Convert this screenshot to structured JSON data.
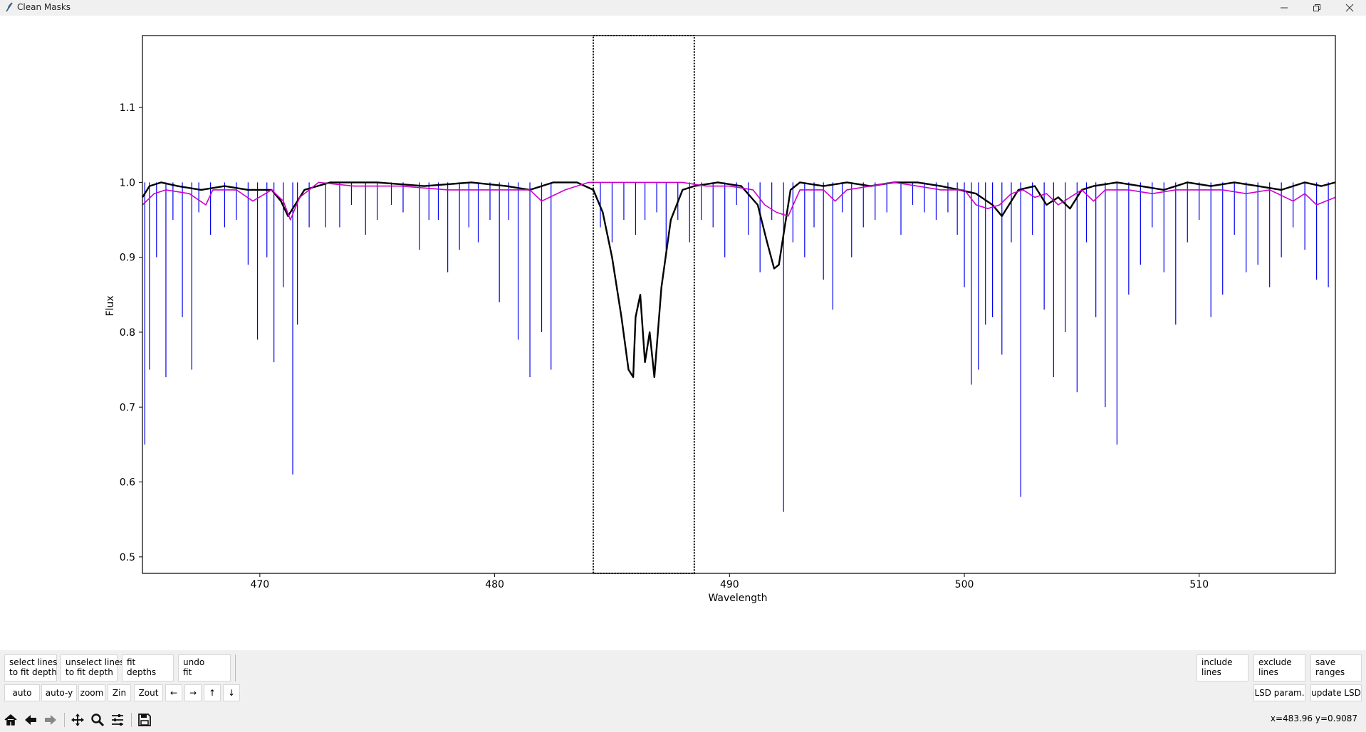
{
  "window": {
    "title": "Clean Masks"
  },
  "toolbar_row1_left": [
    {
      "name": "select-lines-button",
      "label": "select lines\nto fit depth"
    },
    {
      "name": "unselect-lines-button",
      "label": "unselect lines\nto fit depth"
    },
    {
      "name": "fit-depths-button",
      "label": "fit\ndepths"
    },
    {
      "name": "undo-fit-button",
      "label": "undo\nfit"
    }
  ],
  "toolbar_row1_right": [
    {
      "name": "include-lines-button",
      "label": "include\nlines"
    },
    {
      "name": "exclude-lines-button",
      "label": "exclude\nlines"
    },
    {
      "name": "save-ranges-button",
      "label": "save\nranges"
    }
  ],
  "toolbar_row2_left": [
    {
      "name": "auto-button",
      "label": "auto"
    },
    {
      "name": "auto-y-button",
      "label": "auto-y"
    },
    {
      "name": "zoom-button",
      "label": "zoom"
    },
    {
      "name": "zoom-in-button",
      "label": "Zin"
    },
    {
      "name": "zoom-out-button",
      "label": "Zout"
    },
    {
      "name": "pan-left-button",
      "label": "←"
    },
    {
      "name": "pan-right-button",
      "label": "→"
    },
    {
      "name": "pan-up-button",
      "label": "↑"
    },
    {
      "name": "pan-down-button",
      "label": "↓"
    }
  ],
  "toolbar_row2_right": [
    {
      "name": "lsd-param-button",
      "label": "LSD param."
    },
    {
      "name": "update-lsd-button",
      "label": "update LSD"
    }
  ],
  "nav_tools": [
    "home-icon",
    "back-arrow-icon",
    "forward-arrow-icon",
    "pan-move-icon",
    "zoom-magnifier-icon",
    "configure-subplots-icon",
    "save-floppy-icon"
  ],
  "status": {
    "coords": "x=483.96 y=0.9087"
  },
  "colors": {
    "spectrum": "#000000",
    "model": "#cc00cc",
    "mask_lines": "#0000ee"
  },
  "chart_data": {
    "type": "line",
    "xlabel": "Wavelength",
    "ylabel": "Flux",
    "xlim": [
      465,
      515.8
    ],
    "ylim": [
      0.478,
      1.196
    ],
    "xticks": [
      470,
      480,
      490,
      500,
      510
    ],
    "yticks": [
      0.5,
      0.6,
      0.7,
      0.8,
      0.9,
      1.0,
      1.1
    ],
    "grid": false,
    "selection_range": [
      484.2,
      488.5
    ],
    "series": [
      {
        "kind": "observed-spectrum",
        "x": [
          465.0,
          465.3,
          465.8,
          466.5,
          467.5,
          468.5,
          469.5,
          470.5,
          470.9,
          471.2,
          471.5,
          471.9,
          473,
          475,
          477,
          479,
          480.5,
          481.5,
          482.5,
          483.5,
          484.2,
          484.6,
          485.0,
          485.4,
          485.7,
          485.9,
          486.0,
          486.2,
          486.4,
          486.6,
          486.8,
          487.1,
          487.5,
          488.0,
          488.5,
          489.5,
          490.5,
          491.2,
          491.6,
          491.9,
          492.1,
          492.3,
          492.6,
          493.0,
          494,
          495,
          496,
          497,
          498,
          499,
          499.8,
          500.5,
          501.2,
          501.6,
          501.9,
          502.3,
          503,
          503.5,
          504,
          504.5,
          505,
          505.5,
          506.5,
          507.5,
          508.5,
          509.5,
          510.5,
          511.5,
          512.5,
          513.5,
          514.5,
          515.2,
          515.8
        ],
        "y": [
          0.98,
          0.995,
          1.0,
          0.995,
          0.99,
          0.995,
          0.99,
          0.99,
          0.975,
          0.955,
          0.97,
          0.99,
          1.0,
          1.0,
          0.995,
          1.0,
          0.995,
          0.99,
          1.0,
          1.0,
          0.99,
          0.96,
          0.9,
          0.82,
          0.75,
          0.74,
          0.82,
          0.85,
          0.76,
          0.8,
          0.74,
          0.86,
          0.95,
          0.99,
          0.995,
          1.0,
          0.995,
          0.97,
          0.92,
          0.885,
          0.89,
          0.93,
          0.99,
          1.0,
          0.995,
          1.0,
          0.995,
          1.0,
          1.0,
          0.995,
          0.99,
          0.985,
          0.97,
          0.955,
          0.97,
          0.99,
          0.995,
          0.97,
          0.98,
          0.965,
          0.99,
          0.995,
          1.0,
          0.995,
          0.99,
          1.0,
          0.995,
          1.0,
          0.995,
          0.99,
          1.0,
          0.995,
          1.0
        ]
      },
      {
        "kind": "model-spectrum",
        "x": [
          465.0,
          465.5,
          466,
          467,
          467.7,
          468,
          469,
          469.7,
          470.5,
          471,
          471.3,
          471.7,
          472.5,
          474,
          476,
          478,
          480,
          481.5,
          482,
          483,
          484,
          485,
          486,
          487,
          488,
          489,
          490,
          491,
          491.5,
          492,
          492.5,
          493,
          494,
          494.5,
          495,
          496,
          497,
          498,
          499,
          500,
          500.5,
          501,
          501.5,
          502,
          502.5,
          503,
          503.5,
          504,
          505,
          505.5,
          506,
          507,
          508,
          509,
          510,
          511,
          512,
          513,
          514,
          514.5,
          515,
          515.8
        ],
        "y": [
          0.97,
          0.985,
          0.99,
          0.985,
          0.97,
          0.99,
          0.99,
          0.975,
          0.99,
          0.975,
          0.95,
          0.98,
          1.0,
          0.995,
          0.995,
          0.99,
          0.99,
          0.99,
          0.975,
          0.99,
          1.0,
          1.0,
          1.0,
          1.0,
          1.0,
          0.995,
          0.995,
          0.99,
          0.97,
          0.96,
          0.955,
          0.99,
          0.99,
          0.975,
          0.99,
          0.995,
          1.0,
          0.995,
          0.99,
          0.99,
          0.97,
          0.965,
          0.97,
          0.985,
          0.99,
          0.98,
          0.985,
          0.97,
          0.99,
          0.975,
          0.99,
          0.99,
          0.985,
          0.99,
          0.99,
          0.99,
          0.985,
          0.99,
          0.975,
          0.985,
          0.97,
          0.98
        ]
      }
    ],
    "mask_lines": {
      "x": [
        465.1,
        465.3,
        465.6,
        466.0,
        466.3,
        466.7,
        467.1,
        467.4,
        467.9,
        468.5,
        469.0,
        469.5,
        469.9,
        470.3,
        470.6,
        471.0,
        471.4,
        471.6,
        472.1,
        472.8,
        473.4,
        473.9,
        474.5,
        475.0,
        475.6,
        476.1,
        476.8,
        477.2,
        477.6,
        478.0,
        478.5,
        478.9,
        479.3,
        479.8,
        480.2,
        480.6,
        481.0,
        481.5,
        482.0,
        482.4,
        484.5,
        485.0,
        485.5,
        486.0,
        486.4,
        486.9,
        487.3,
        487.8,
        488.3,
        488.8,
        489.3,
        489.8,
        490.3,
        490.8,
        491.3,
        491.8,
        492.3,
        492.7,
        493.2,
        493.6,
        494.0,
        494.4,
        494.8,
        495.2,
        495.7,
        496.2,
        496.7,
        497.3,
        497.8,
        498.3,
        498.8,
        499.3,
        499.7,
        500.0,
        500.3,
        500.6,
        500.9,
        501.2,
        501.6,
        502.0,
        502.4,
        502.9,
        503.4,
        503.8,
        504.3,
        504.8,
        505.2,
        505.6,
        506.0,
        506.5,
        507.0,
        507.5,
        508.0,
        508.5,
        509.0,
        509.5,
        510.0,
        510.5,
        511.0,
        511.5,
        512.0,
        512.5,
        513.0,
        513.5,
        514.0,
        514.5,
        515.0,
        515.5
      ],
      "depth": [
        0.35,
        0.25,
        0.1,
        0.26,
        0.05,
        0.18,
        0.25,
        0.04,
        0.07,
        0.06,
        0.05,
        0.11,
        0.21,
        0.1,
        0.24,
        0.14,
        0.39,
        0.19,
        0.06,
        0.06,
        0.06,
        0.03,
        0.07,
        0.05,
        0.03,
        0.04,
        0.09,
        0.05,
        0.05,
        0.12,
        0.09,
        0.06,
        0.08,
        0.05,
        0.16,
        0.05,
        0.21,
        0.26,
        0.2,
        0.25,
        0.06,
        0.08,
        0.05,
        0.07,
        0.05,
        0.04,
        0.09,
        0.05,
        0.08,
        0.05,
        0.06,
        0.1,
        0.03,
        0.07,
        0.12,
        0.05,
        0.44,
        0.08,
        0.1,
        0.06,
        0.13,
        0.17,
        0.04,
        0.1,
        0.06,
        0.05,
        0.04,
        0.07,
        0.03,
        0.04,
        0.05,
        0.04,
        0.07,
        0.14,
        0.27,
        0.25,
        0.19,
        0.18,
        0.23,
        0.08,
        0.42,
        0.07,
        0.17,
        0.26,
        0.2,
        0.28,
        0.08,
        0.18,
        0.3,
        0.35,
        0.15,
        0.11,
        0.06,
        0.12,
        0.19,
        0.08,
        0.05,
        0.18,
        0.15,
        0.07,
        0.12,
        0.11,
        0.14,
        0.1,
        0.06,
        0.09,
        0.13,
        0.14
      ]
    }
  }
}
